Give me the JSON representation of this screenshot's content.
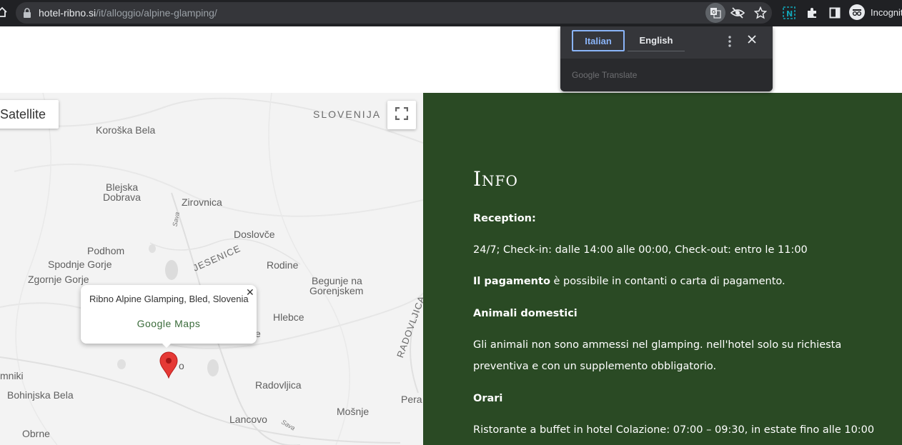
{
  "browser": {
    "url_domain": "hotel-ribno.si",
    "url_path": "/it/alloggio/alpine-glamping/",
    "profile_label": "Incognito"
  },
  "translate_popup": {
    "source_lang": "Italian",
    "target_lang": "English",
    "footer_brand": "Google",
    "footer_product": "Translate"
  },
  "map": {
    "map_type_label": "Satellite",
    "places": {
      "country": "SLOVENIJA",
      "koroska_bela": "Koroška Bela",
      "blejska_1": "Blejska",
      "blejska_2": "Dobrava",
      "zirovnica": "Zirovnica",
      "sava_1": "Sava",
      "doslovce": "Doslovče",
      "podhom": "Podhom",
      "spodnje_gorje": "Spodnje Gorje",
      "zgornje_gorje": "Zgornje Gorje",
      "jesenice": "JESENICE",
      "rodine": "Rodine",
      "begunje_1": "Begunje na",
      "begunje_2": "Gorenjskem",
      "hlebce": "Hlebce",
      "radovljica_caps": "RADOVLJICA",
      "bled_partial": "e",
      "ribno_partial": "o",
      "mniki": "mniki",
      "bohinjska_bela": "Bohinjska Bela",
      "radovljica": "Radovljica",
      "perac": "Pera",
      "lancovo": "Lancovo",
      "mosnje": "Mošnje",
      "sava_2": "Sava",
      "obrne": "Obrne"
    },
    "infowindow": {
      "title": "Ribno Alpine Glamping, Bled, Slovenia",
      "link": "Google Maps"
    },
    "colors": {
      "marker": "#e53935"
    }
  },
  "info": {
    "heading": "Info",
    "reception_label": "Reception:",
    "reception_text": "24/7; Check-in: dalle 14:00 alle 00:00, Check-out: entro le 11:00",
    "payment_bold": "Il pagamento",
    "payment_rest": " è possibile in contanti o carta di pagamento.",
    "pets_label": "Animali domestici",
    "pets_line1": "Gli animali non sono ammessi nel glamping. nell'hotel solo su richiesta",
    "pets_line2": "preventiva e con un supplemento obbligatorio.",
    "hours_label": "Orari",
    "hours_text": "Ristorante a buffet in hotel Colazione: 07:00 – 09:30, in estate fino alle 10:00",
    "colors": {
      "panel_bg": "#2a4a24"
    }
  }
}
